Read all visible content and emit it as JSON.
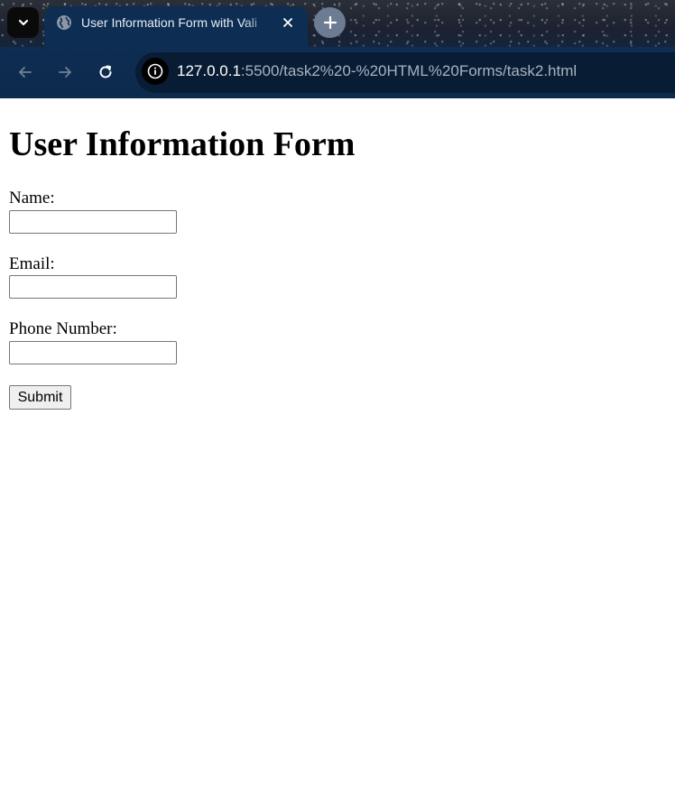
{
  "browser": {
    "tab": {
      "title": "User Information Form with Vali",
      "favicon": "globe-icon"
    },
    "toolbar": {
      "back_icon": "arrow-left-icon",
      "forward_icon": "arrow-right-icon",
      "reload_icon": "reload-icon",
      "site_info_icon": "info-icon"
    },
    "address": {
      "host": "127.0.0.1",
      "path": ":5500/task2%20-%20HTML%20Forms/task2.html"
    },
    "colors": {
      "tab_active": "#0e2d52",
      "toolbar": "#0e2d52",
      "new_tab_button": "#6b7c93"
    }
  },
  "page": {
    "heading": "User Information Form",
    "fields": [
      {
        "label": "Name:",
        "value": "",
        "placeholder": ""
      },
      {
        "label": "Email:",
        "value": "",
        "placeholder": ""
      },
      {
        "label": "Phone Number:",
        "value": "",
        "placeholder": ""
      }
    ],
    "submit_label": "Submit"
  }
}
